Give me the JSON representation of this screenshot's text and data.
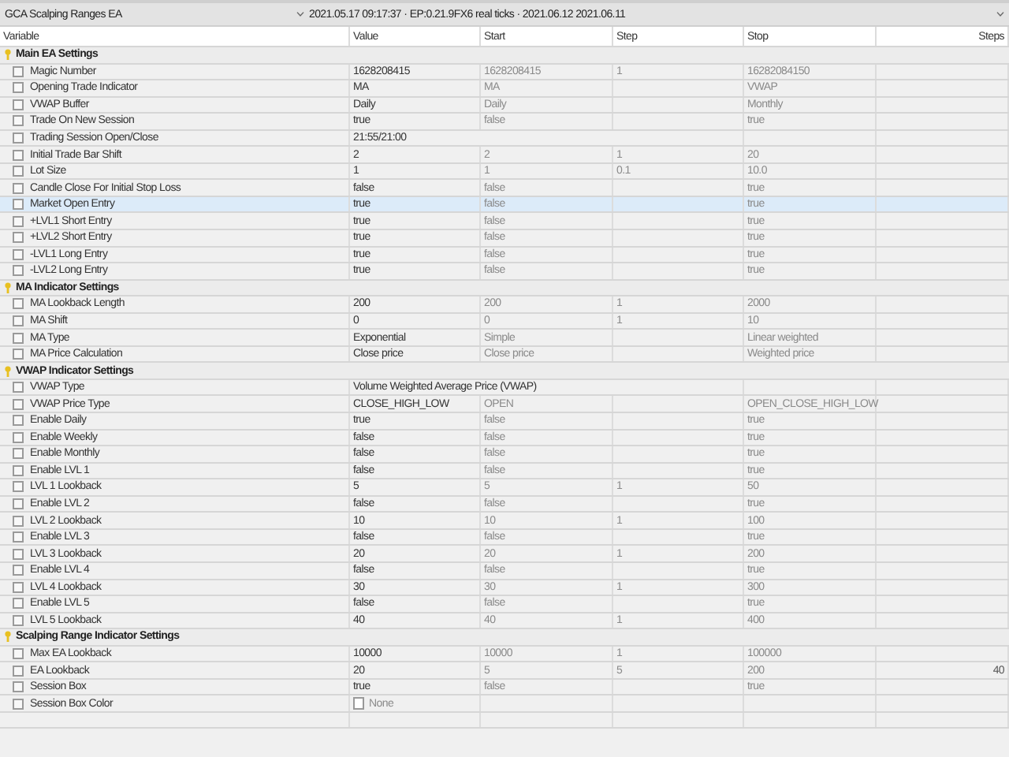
{
  "toolbar": {
    "expert": "GCA Scalping Ranges EA",
    "info": "2021.05.17 09:17:37 · EP:0.21.9FX6 real ticks · 2021.06.12 2021.06.11"
  },
  "columns": [
    "Variable",
    "Value",
    "Start",
    "Step",
    "Stop",
    "Steps"
  ],
  "groups": [
    {
      "title": "Main EA Settings",
      "rows": [
        {
          "kind": "param",
          "checked": false,
          "selected": false,
          "variable": "Magic Number",
          "value": "1628208415",
          "start": "1628208415",
          "step": "1",
          "stop": "16282084150"
        },
        {
          "kind": "param",
          "checked": false,
          "selected": false,
          "variable": "Opening Trade Indicator",
          "value": "MA",
          "start": "MA",
          "stop": "VWAP"
        },
        {
          "kind": "param",
          "checked": false,
          "selected": false,
          "variable": "VWAP Buffer",
          "value": "Daily",
          "start": "Daily",
          "stop": "Monthly"
        },
        {
          "kind": "param",
          "checked": false,
          "selected": false,
          "variable": "Trade On New Session",
          "value": "true",
          "start": "false",
          "stop": "true"
        },
        {
          "kind": "param",
          "checked": false,
          "selected": false,
          "variable": "Trading Session Open/Close",
          "value": "21:55/21:00"
        },
        {
          "kind": "param",
          "checked": false,
          "selected": false,
          "variable": "Initial Trade Bar Shift",
          "value": "2",
          "start": "2",
          "step": "1",
          "stop": "20"
        },
        {
          "kind": "param",
          "checked": false,
          "selected": false,
          "variable": "Lot Size",
          "value": "1",
          "start": "1",
          "step": "0.1",
          "stop": "10.0"
        },
        {
          "kind": "param",
          "checked": false,
          "selected": false,
          "variable": "Candle Close For Initial Stop Loss",
          "value": "false",
          "start": "false",
          "stop": "true"
        },
        {
          "kind": "param",
          "checked": false,
          "selected": true,
          "variable": "Market Open Entry",
          "value": "true",
          "start": "false",
          "stop": "true"
        },
        {
          "kind": "param",
          "checked": false,
          "selected": false,
          "variable": "+LVL1 Short Entry",
          "value": "true",
          "start": "false",
          "stop": "true"
        },
        {
          "kind": "param",
          "checked": false,
          "selected": false,
          "variable": "+LVL2 Short Entry",
          "value": "true",
          "start": "false",
          "stop": "true"
        },
        {
          "kind": "param",
          "checked": false,
          "selected": false,
          "variable": "-LVL1 Long Entry",
          "value": "true",
          "start": "false",
          "stop": "true"
        },
        {
          "kind": "param",
          "checked": false,
          "selected": false,
          "variable": "-LVL2 Long Entry",
          "value": "true",
          "start": "false",
          "stop": "true"
        }
      ]
    },
    {
      "title": "MA Indicator Settings",
      "rows": [
        {
          "kind": "param",
          "checked": false,
          "selected": false,
          "variable": "MA Lookback Length",
          "value": "200",
          "start": "200",
          "step": "1",
          "stop": "2000"
        },
        {
          "kind": "param",
          "checked": false,
          "selected": false,
          "variable": "MA Shift",
          "value": "0",
          "start": "0",
          "step": "1",
          "stop": "10"
        },
        {
          "kind": "param",
          "checked": false,
          "selected": false,
          "variable": "MA Type",
          "value": "Exponential",
          "start": "Simple",
          "stop": "Linear weighted"
        },
        {
          "kind": "param",
          "checked": false,
          "selected": false,
          "variable": "MA Price Calculation",
          "value": "Close price",
          "start": "Close price",
          "stop": "Weighted price"
        }
      ]
    },
    {
      "title": "VWAP Indicator Settings",
      "rows": [
        {
          "kind": "param",
          "checked": false,
          "selected": false,
          "variable": "VWAP Type",
          "value": "Volume Weighted Average Price (VWAP)"
        },
        {
          "kind": "param",
          "checked": false,
          "selected": false,
          "variable": "VWAP Price Type",
          "value": "CLOSE_HIGH_LOW",
          "start": "OPEN",
          "stop": "OPEN_CLOSE_HIGH_LOW"
        },
        {
          "kind": "param",
          "checked": false,
          "selected": false,
          "variable": "Enable Daily",
          "value": "true",
          "start": "false",
          "stop": "true"
        },
        {
          "kind": "param",
          "checked": false,
          "selected": false,
          "variable": "Enable Weekly",
          "value": "false",
          "start": "false",
          "stop": "true"
        },
        {
          "kind": "param",
          "checked": false,
          "selected": false,
          "variable": "Enable Monthly",
          "value": "false",
          "start": "false",
          "stop": "true"
        },
        {
          "kind": "param",
          "checked": false,
          "selected": false,
          "variable": "Enable LVL 1",
          "value": "false",
          "start": "false",
          "stop": "true"
        },
        {
          "kind": "param",
          "checked": false,
          "selected": false,
          "variable": "LVL 1 Lookback",
          "value": "5",
          "start": "5",
          "step": "1",
          "stop": "50"
        },
        {
          "kind": "param",
          "checked": false,
          "selected": false,
          "variable": "Enable LVL 2",
          "value": "false",
          "start": "false",
          "stop": "true"
        },
        {
          "kind": "param",
          "checked": false,
          "selected": false,
          "variable": "LVL 2 Lookback",
          "value": "10",
          "start": "10",
          "step": "1",
          "stop": "100"
        },
        {
          "kind": "param",
          "checked": false,
          "selected": false,
          "variable": "Enable LVL 3",
          "value": "false",
          "start": "false",
          "stop": "true"
        },
        {
          "kind": "param",
          "checked": false,
          "selected": false,
          "variable": "LVL 3 Lookback",
          "value": "20",
          "start": "20",
          "step": "1",
          "stop": "200"
        },
        {
          "kind": "param",
          "checked": false,
          "selected": false,
          "variable": "Enable LVL 4",
          "value": "false",
          "start": "false",
          "stop": "true"
        },
        {
          "kind": "param",
          "checked": false,
          "selected": false,
          "variable": "LVL 4 Lookback",
          "value": "30",
          "start": "30",
          "step": "1",
          "stop": "300"
        },
        {
          "kind": "param",
          "checked": false,
          "selected": false,
          "variable": "Enable LVL 5",
          "value": "false",
          "start": "false",
          "stop": "true"
        },
        {
          "kind": "param",
          "checked": false,
          "selected": false,
          "variable": "LVL 5 Lookback",
          "value": "40",
          "start": "40",
          "step": "1",
          "stop": "400"
        }
      ]
    },
    {
      "title": "Scalping Range Indicator Settings",
      "rows": [
        {
          "kind": "param",
          "checked": false,
          "selected": false,
          "variable": "Max EA Lookback",
          "value": "10000",
          "start": "10000",
          "step": "1",
          "stop": "100000"
        },
        {
          "kind": "param",
          "checked": false,
          "selected": false,
          "variable": "EA Lookback",
          "value": "20",
          "start": "5",
          "step": "5",
          "stop": "200",
          "steps": "40"
        },
        {
          "kind": "param",
          "checked": false,
          "selected": false,
          "variable": "Session Box",
          "value": "true",
          "start": "false",
          "stop": "true"
        },
        {
          "kind": "color",
          "checked": false,
          "selected": false,
          "variable": "Session Box Color",
          "value": "None"
        }
      ]
    }
  ]
}
